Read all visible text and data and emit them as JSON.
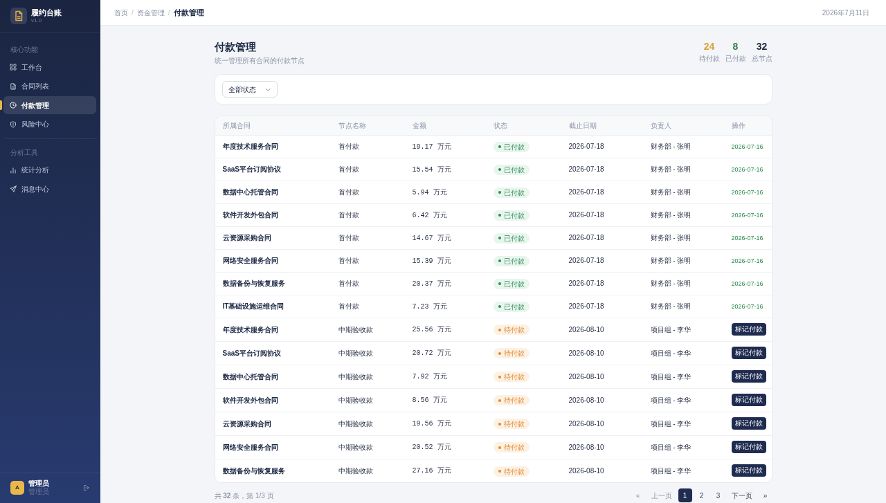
{
  "sidebar": {
    "brand": {
      "title": "履约台账",
      "version": "v1.0"
    },
    "sections": [
      {
        "title": "核心功能",
        "items": [
          {
            "label": "工作台",
            "selected": false
          },
          {
            "label": "合同列表",
            "selected": false
          },
          {
            "label": "付款管理",
            "selected": true
          },
          {
            "label": "风险中心",
            "selected": false
          }
        ]
      },
      {
        "title": "分析工具",
        "items": [
          {
            "label": "统计分析",
            "selected": false
          },
          {
            "label": "消息中心",
            "selected": false
          }
        ]
      }
    ],
    "user": {
      "avatar": "A",
      "name": "管理员",
      "role": "管理员"
    }
  },
  "header": {
    "breadcrumb": [
      {
        "kind": "link",
        "label": "首页"
      },
      {
        "kind": "separator",
        "label": "/"
      },
      {
        "kind": "link",
        "label": "资金管理"
      },
      {
        "kind": "separator",
        "label": "/"
      },
      {
        "kind": "current",
        "label": "付款管理"
      }
    ],
    "date": "2026年7月11日"
  },
  "page": {
    "title": "付款管理",
    "subtitle": "统一管理所有合同的付款节点",
    "stats": [
      {
        "value": "24",
        "label": "待付款",
        "color": "#d9a23a"
      },
      {
        "value": "8",
        "label": "已付款",
        "color": "#2e7d4a"
      },
      {
        "value": "32",
        "label": "总节点",
        "color": "#1e2940"
      }
    ]
  },
  "filter": {
    "value": "全部状态"
  },
  "table": {
    "columns": [
      "所属合同",
      "节点名称",
      "金额",
      "状态",
      "截止日期",
      "负责人",
      "操作"
    ],
    "rows": [
      {
        "contract": "年度技术服务合同",
        "node": "首付款",
        "amount": "19.17 万元",
        "status": {
          "kind": "paid",
          "label": "已付款"
        },
        "due": "2026-07-18",
        "owner": "财务部 - 张明",
        "action": {
          "kind": "date",
          "text": "2026-07-16"
        }
      },
      {
        "contract": "SaaS平台订阅协议",
        "node": "首付款",
        "amount": "15.54 万元",
        "status": {
          "kind": "paid",
          "label": "已付款"
        },
        "due": "2026-07-18",
        "owner": "财务部 - 张明",
        "action": {
          "kind": "date",
          "text": "2026-07-16"
        }
      },
      {
        "contract": "数据中心托管合同",
        "node": "首付款",
        "amount": "5.94 万元",
        "status": {
          "kind": "paid",
          "label": "已付款"
        },
        "due": "2026-07-18",
        "owner": "财务部 - 张明",
        "action": {
          "kind": "date",
          "text": "2026-07-16"
        }
      },
      {
        "contract": "软件开发外包合同",
        "node": "首付款",
        "amount": "6.42 万元",
        "status": {
          "kind": "paid",
          "label": "已付款"
        },
        "due": "2026-07-18",
        "owner": "财务部 - 张明",
        "action": {
          "kind": "date",
          "text": "2026-07-16"
        }
      },
      {
        "contract": "云资源采购合同",
        "node": "首付款",
        "amount": "14.67 万元",
        "status": {
          "kind": "paid",
          "label": "已付款"
        },
        "due": "2026-07-18",
        "owner": "财务部 - 张明",
        "action": {
          "kind": "date",
          "text": "2026-07-16"
        }
      },
      {
        "contract": "网络安全服务合同",
        "node": "首付款",
        "amount": "15.39 万元",
        "status": {
          "kind": "paid",
          "label": "已付款"
        },
        "due": "2026-07-18",
        "owner": "财务部 - 张明",
        "action": {
          "kind": "date",
          "text": "2026-07-16"
        }
      },
      {
        "contract": "数据备份与恢复服务",
        "node": "首付款",
        "amount": "20.37 万元",
        "status": {
          "kind": "paid",
          "label": "已付款"
        },
        "due": "2026-07-18",
        "owner": "财务部 - 张明",
        "action": {
          "kind": "date",
          "text": "2026-07-16"
        }
      },
      {
        "contract": "IT基础设施运维合同",
        "node": "首付款",
        "amount": "7.23 万元",
        "status": {
          "kind": "paid",
          "label": "已付款"
        },
        "due": "2026-07-18",
        "owner": "财务部 - 张明",
        "action": {
          "kind": "date",
          "text": "2026-07-16"
        }
      },
      {
        "contract": "年度技术服务合同",
        "node": "中期验收款",
        "amount": "25.56 万元",
        "status": {
          "kind": "pending",
          "label": "待付款"
        },
        "due": "2026-08-10",
        "owner": "项目组 - 李华",
        "action": {
          "kind": "button",
          "text": "标记付款"
        }
      },
      {
        "contract": "SaaS平台订阅协议",
        "node": "中期验收款",
        "amount": "20.72 万元",
        "status": {
          "kind": "pending",
          "label": "待付款"
        },
        "due": "2026-08-10",
        "owner": "项目组 - 李华",
        "action": {
          "kind": "button",
          "text": "标记付款"
        }
      },
      {
        "contract": "数据中心托管合同",
        "node": "中期验收款",
        "amount": "7.92 万元",
        "status": {
          "kind": "pending",
          "label": "待付款"
        },
        "due": "2026-08-10",
        "owner": "项目组 - 李华",
        "action": {
          "kind": "button",
          "text": "标记付款"
        }
      },
      {
        "contract": "软件开发外包合同",
        "node": "中期验收款",
        "amount": "8.56 万元",
        "status": {
          "kind": "pending",
          "label": "待付款"
        },
        "due": "2026-08-10",
        "owner": "项目组 - 李华",
        "action": {
          "kind": "button",
          "text": "标记付款"
        }
      },
      {
        "contract": "云资源采购合同",
        "node": "中期验收款",
        "amount": "19.56 万元",
        "status": {
          "kind": "pending",
          "label": "待付款"
        },
        "due": "2026-08-10",
        "owner": "项目组 - 李华",
        "action": {
          "kind": "button",
          "text": "标记付款"
        }
      },
      {
        "contract": "网络安全服务合同",
        "node": "中期验收款",
        "amount": "20.52 万元",
        "status": {
          "kind": "pending",
          "label": "待付款"
        },
        "due": "2026-08-10",
        "owner": "项目组 - 李华",
        "action": {
          "kind": "button",
          "text": "标记付款"
        }
      },
      {
        "contract": "数据备份与恢复服务",
        "node": "中期验收款",
        "amount": "27.16 万元",
        "status": {
          "kind": "pending",
          "label": "待付款"
        },
        "due": "2026-08-10",
        "owner": "项目组 - 李华",
        "action": {
          "kind": "button",
          "text": "标记付款"
        }
      }
    ]
  },
  "pagination": {
    "summary": "共 **32** 条，第 1/3 页",
    "prev": [
      {
        "label": "«",
        "disabled": true
      },
      {
        "label": "上一页",
        "disabled": true
      }
    ],
    "pages": [
      {
        "label": "1",
        "selected": true
      },
      {
        "label": "2",
        "selected": false
      },
      {
        "label": "3",
        "selected": false
      }
    ],
    "next": [
      {
        "label": "下一页",
        "disabled": false
      },
      {
        "label": "»",
        "disabled": false
      }
    ]
  }
}
